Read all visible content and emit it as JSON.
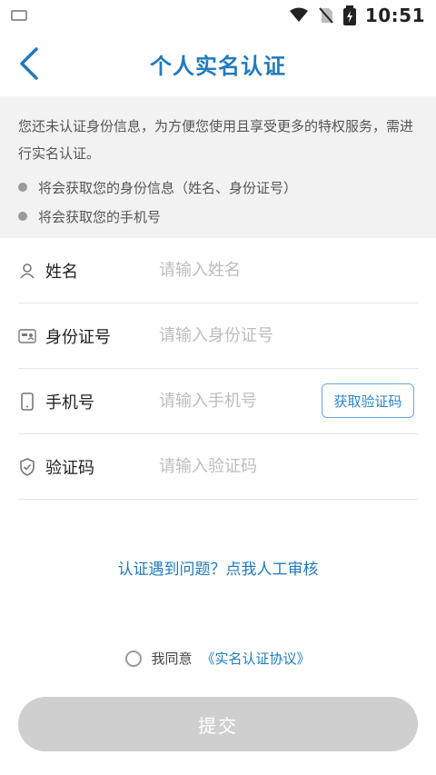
{
  "status_bar": {
    "time": "10:51",
    "icons": [
      "keyboard-icon",
      "wifi-icon",
      "no-sim-icon",
      "battery-charging-icon"
    ]
  },
  "header": {
    "title": "个人实名认证",
    "back_icon": "chevron-left-icon"
  },
  "notice": {
    "text": "您还未认证身份信息，为方便您使用且享受更多的特权服务，需进行实名认证。",
    "bullets": [
      "将会获取您的身份信息（姓名、身份证号）",
      "将会获取您的手机号"
    ]
  },
  "form": {
    "name": {
      "label": "姓名",
      "placeholder": "请输入姓名",
      "icon": "person-icon"
    },
    "id": {
      "label": "身份证号",
      "placeholder": "请输入身份证号",
      "icon": "id-card-icon"
    },
    "phone": {
      "label": "手机号",
      "placeholder": "请输入手机号",
      "icon": "phone-icon",
      "code_button": "获取验证码"
    },
    "code": {
      "label": "验证码",
      "placeholder": "请输入验证码",
      "icon": "shield-icon"
    }
  },
  "help_link": "认证遇到问题？点我人工审核",
  "agreement": {
    "prefix": "我同意",
    "link": "《实名认证协议》"
  },
  "submit_label": "提交",
  "colors": {
    "accent": "#1f7ac0",
    "notice_bg": "#f2f2f2",
    "button_disabled": "#cfcfcf"
  }
}
